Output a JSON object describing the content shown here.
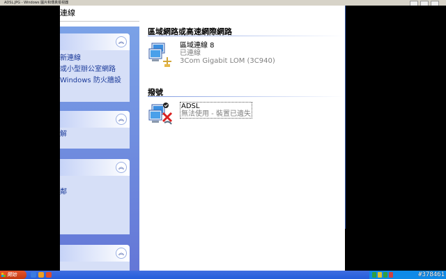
{
  "background_window": {
    "title": "ADSL.JPG - Windows 圖片和傳真檢視器"
  },
  "address_bar": {
    "text": "連線"
  },
  "task_pane": {
    "panels": [
      {
        "links": [
          "新連線",
          "或小型辦公室網路",
          "Windows 防火牆設"
        ]
      },
      {
        "links": [
          "解"
        ]
      },
      {
        "links": [
          "鄰"
        ]
      },
      {
        "links": []
      }
    ]
  },
  "content": {
    "lan_group": {
      "title": "區域網路或高速網際網路",
      "connection": {
        "name": "區域連線 8",
        "status": "已連線",
        "device": "3Com Gigabit LOM (3C940)"
      }
    },
    "dialup_group": {
      "title": "撥號",
      "connection": {
        "name": "ADSL",
        "status": "無法使用 - 裝置已遺失"
      }
    }
  },
  "taskbar": {
    "start_label": "開始",
    "watermark": "#378461"
  },
  "colors": {
    "task_pane_top": "#7ba2e7",
    "task_pane_bottom": "#6375d6",
    "link": "#1c3b9a",
    "taskbar": "#245edb",
    "start": "#c1370f"
  },
  "icons": {
    "collapse": "chevron-up-double-icon",
    "lan": "network-computer-icon",
    "dialup": "dialup-connection-disabled-icon"
  }
}
